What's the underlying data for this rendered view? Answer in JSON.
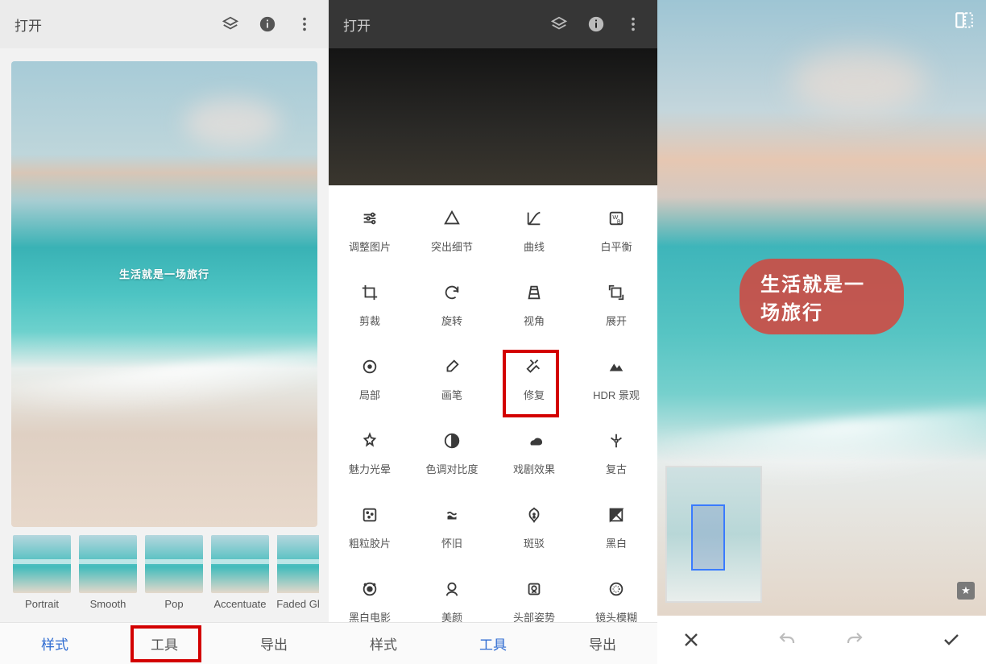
{
  "panel1": {
    "open": "打开",
    "watermark": "生活就是一场旅行",
    "styles": [
      {
        "label": "Portrait"
      },
      {
        "label": "Smooth"
      },
      {
        "label": "Pop"
      },
      {
        "label": "Accentuate"
      },
      {
        "label": "Faded Gl"
      }
    ],
    "tabs": {
      "styles": "样式",
      "tools": "工具",
      "export": "导出"
    },
    "highlighted_tab": "tools"
  },
  "panel2": {
    "open": "打开",
    "tools": [
      {
        "label": "调整图片",
        "icon": "tune"
      },
      {
        "label": "突出细节",
        "icon": "details"
      },
      {
        "label": "曲线",
        "icon": "curves"
      },
      {
        "label": "白平衡",
        "icon": "wb"
      },
      {
        "label": "剪裁",
        "icon": "crop"
      },
      {
        "label": "旋转",
        "icon": "rotate"
      },
      {
        "label": "视角",
        "icon": "perspective"
      },
      {
        "label": "展开",
        "icon": "expand"
      },
      {
        "label": "局部",
        "icon": "selective"
      },
      {
        "label": "画笔",
        "icon": "brush"
      },
      {
        "label": "修复",
        "icon": "healing"
      },
      {
        "label": "HDR 景观",
        "icon": "hdr"
      },
      {
        "label": "魅力光晕",
        "icon": "glow"
      },
      {
        "label": "色调对比度",
        "icon": "tonal"
      },
      {
        "label": "戏剧效果",
        "icon": "drama"
      },
      {
        "label": "复古",
        "icon": "vintage"
      },
      {
        "label": "粗粒胶片",
        "icon": "grainy"
      },
      {
        "label": "怀旧",
        "icon": "retrolux"
      },
      {
        "label": "斑驳",
        "icon": "grunge"
      },
      {
        "label": "黑白",
        "icon": "bw"
      },
      {
        "label": "黑白电影",
        "icon": "noir"
      },
      {
        "label": "美颜",
        "icon": "portrait"
      },
      {
        "label": "头部姿势",
        "icon": "head"
      },
      {
        "label": "镜头模糊",
        "icon": "lensblur"
      }
    ],
    "highlighted_tool_index": 10,
    "tabs": {
      "styles": "样式",
      "tools": "工具",
      "export": "导出"
    },
    "active_tab": "tools"
  },
  "panel3": {
    "bubble_text": "生活就是一场旅行"
  }
}
